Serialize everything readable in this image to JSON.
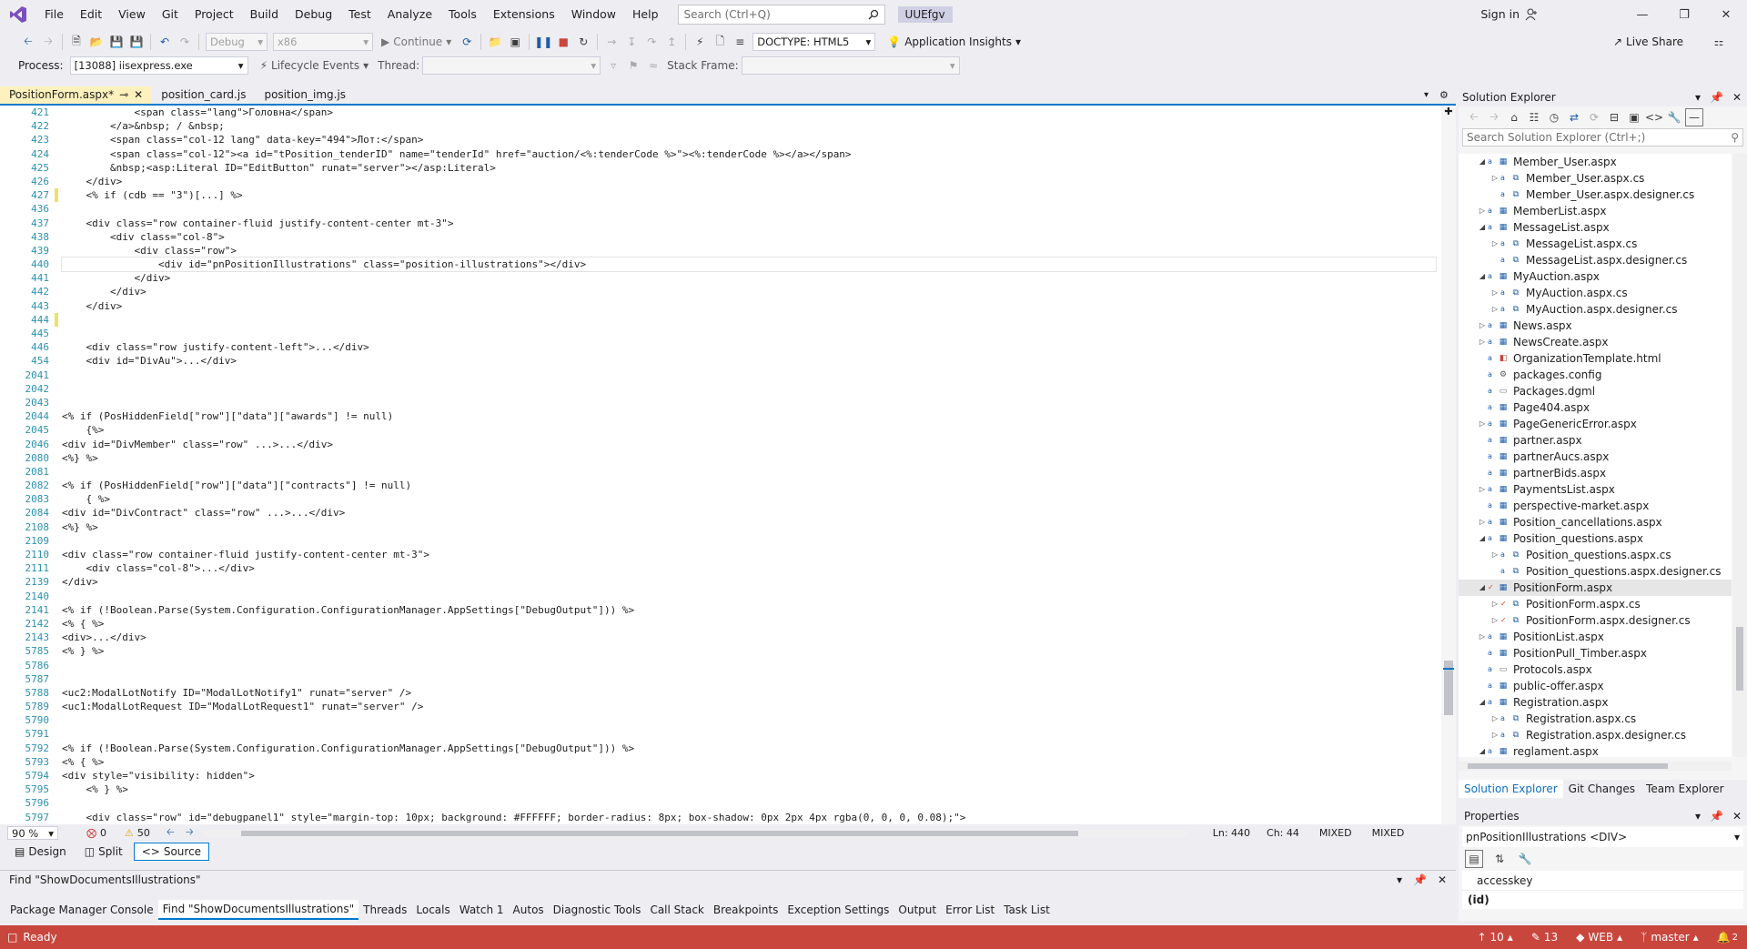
{
  "menu": [
    "File",
    "Edit",
    "View",
    "Git",
    "Project",
    "Build",
    "Debug",
    "Test",
    "Analyze",
    "Tools",
    "Extensions",
    "Window",
    "Help"
  ],
  "search": {
    "placeholder": "Search (Ctrl+Q)"
  },
  "solution_name": "UUEfgv",
  "signin": "Sign in",
  "toolbar": {
    "config": "Debug",
    "platform": "x86",
    "continue": "Continue",
    "doctype": "DOCTYPE: HTML5",
    "app_insights": "Application Insights",
    "live_share": "Live Share"
  },
  "toolbar2": {
    "process_label": "Process:",
    "process_value": "[13088] iisexpress.exe",
    "lifecycle": "Lifecycle Events",
    "thread_label": "Thread:",
    "stack_label": "Stack Frame:"
  },
  "doc_tabs": [
    {
      "label": "PositionForm.aspx*",
      "active": true
    },
    {
      "label": "position_card.js",
      "active": false
    },
    {
      "label": "position_img.js",
      "active": false
    }
  ],
  "editor": {
    "lines": [
      {
        "n": "421",
        "t": "            <span class=\"lang\">Головна</span>"
      },
      {
        "n": "422",
        "t": "        </a>&nbsp; / &nbsp;"
      },
      {
        "n": "423",
        "t": "        <span class=\"col-12 lang\" data-key=\"494\">Лот:</span>"
      },
      {
        "n": "424",
        "t": "        <span class=\"col-12\"><a id=\"tPosition_tenderID\" name=\"tenderId\" href=\"auction/<%:tenderCode %>\"><%:tenderCode %></a></span>"
      },
      {
        "n": "425",
        "t": "        &nbsp;<asp:Literal ID=\"EditButton\" runat=\"server\"></asp:Literal>"
      },
      {
        "n": "426",
        "t": "    </div>"
      },
      {
        "n": "427",
        "t": "    <% if (cdb == \"3\")[...] %>"
      },
      {
        "n": "436",
        "t": ""
      },
      {
        "n": "437",
        "t": "    <div class=\"row container-fluid justify-content-center mt-3\">"
      },
      {
        "n": "438",
        "t": "        <div class=\"col-8\">"
      },
      {
        "n": "439",
        "t": "            <div class=\"row\">"
      },
      {
        "n": "440",
        "t": "                <div id=\"pnPositionIllustrations\" class=\"position-illustrations\"></div>",
        "current": true
      },
      {
        "n": "441",
        "t": "            </div>"
      },
      {
        "n": "442",
        "t": "        </div>"
      },
      {
        "n": "443",
        "t": "    </div>"
      },
      {
        "n": "444",
        "t": ""
      },
      {
        "n": "445",
        "t": ""
      },
      {
        "n": "446",
        "t": "    <div class=\"row justify-content-left\">...</div>"
      },
      {
        "n": "454",
        "t": "    <div id=\"DivAu\">...</div>"
      },
      {
        "n": "2041",
        "t": ""
      },
      {
        "n": "2042",
        "t": ""
      },
      {
        "n": "2043",
        "t": ""
      },
      {
        "n": "2044",
        "t": "<% if (PosHiddenField[\"row\"][\"data\"][\"awards\"] != null)"
      },
      {
        "n": "2045",
        "t": "    {%>"
      },
      {
        "n": "2046",
        "t": "<div id=\"DivMember\" class=\"row\" ...>...</div>"
      },
      {
        "n": "2080",
        "t": "<%} %>"
      },
      {
        "n": "2081",
        "t": ""
      },
      {
        "n": "2082",
        "t": "<% if (PosHiddenField[\"row\"][\"data\"][\"contracts\"] != null)"
      },
      {
        "n": "2083",
        "t": "    { %>"
      },
      {
        "n": "2084",
        "t": "<div id=\"DivContract\" class=\"row\" ...>...</div>"
      },
      {
        "n": "2108",
        "t": "<%} %>"
      },
      {
        "n": "2109",
        "t": ""
      },
      {
        "n": "2110",
        "t": "<div class=\"row container-fluid justify-content-center mt-3\">"
      },
      {
        "n": "2111",
        "t": "    <div class=\"col-8\">...</div>"
      },
      {
        "n": "2139",
        "t": "</div>"
      },
      {
        "n": "2140",
        "t": ""
      },
      {
        "n": "2141",
        "t": "<% if (!Boolean.Parse(System.Configuration.ConfigurationManager.AppSettings[\"DebugOutput\"])) %>"
      },
      {
        "n": "2142",
        "t": "<% { %>"
      },
      {
        "n": "2143",
        "t": "<div>...</div>"
      },
      {
        "n": "5785",
        "t": "<% } %>"
      },
      {
        "n": "5786",
        "t": ""
      },
      {
        "n": "5787",
        "t": ""
      },
      {
        "n": "5788",
        "t": "<uc2:ModalLotNotify ID=\"ModalLotNotify1\" runat=\"server\" />"
      },
      {
        "n": "5789",
        "t": "<uc1:ModalLotRequest ID=\"ModalLotRequest1\" runat=\"server\" />"
      },
      {
        "n": "5790",
        "t": ""
      },
      {
        "n": "5791",
        "t": ""
      },
      {
        "n": "5792",
        "t": "<% if (!Boolean.Parse(System.Configuration.ConfigurationManager.AppSettings[\"DebugOutput\"])) %>"
      },
      {
        "n": "5793",
        "t": "<% { %>"
      },
      {
        "n": "5794",
        "t": "<div style=\"visibility: hidden\">"
      },
      {
        "n": "5795",
        "t": "    <% } %>"
      },
      {
        "n": "5796",
        "t": ""
      },
      {
        "n": "5797",
        "t": "    <div class=\"row\" id=\"debugpanel1\" style=\"margin-top: 10px; background: #FFFFFF; border-radius: 8px; box-shadow: 0px 2px 4px rgba(0, 0, 0, 0.08);\">"
      }
    ]
  },
  "editor_status": {
    "zoom": "90 %",
    "errors": "0",
    "warnings": "50",
    "ln": "Ln: 440",
    "ch": "Ch: 44",
    "enc1": "MIXED",
    "enc2": "MIXED"
  },
  "view_buttons": [
    "Design",
    "Split",
    "Source"
  ],
  "find_title": "Find \"ShowDocumentsIllustrations\"",
  "bottom_tabs": [
    "Package Manager Console",
    "Find \"ShowDocumentsIllustrations\"",
    "Threads",
    "Locals",
    "Watch 1",
    "Autos",
    "Diagnostic Tools",
    "Call Stack",
    "Breakpoints",
    "Exception Settings",
    "Output",
    "Error List",
    "Task List"
  ],
  "status": {
    "ready": "Ready",
    "up": "10",
    "pencil": "13",
    "project": "WEB",
    "branch": "master",
    "notif": "2"
  },
  "solution_explorer": {
    "title": "Solution Explorer",
    "search_placeholder": "Search Solution Explorer (Ctrl+;)",
    "items": [
      {
        "label": "Member_User.aspx",
        "depth": 0,
        "exp": "open",
        "icon": "page"
      },
      {
        "label": "Member_User.aspx.cs",
        "depth": 1,
        "exp": "closed",
        "icon": "cs"
      },
      {
        "label": "Member_User.aspx.designer.cs",
        "depth": 1,
        "exp": "",
        "icon": "cs"
      },
      {
        "label": "MemberList.aspx",
        "depth": 0,
        "exp": "closed",
        "icon": "page"
      },
      {
        "label": "MessageList.aspx",
        "depth": 0,
        "exp": "open",
        "icon": "page"
      },
      {
        "label": "MessageList.aspx.cs",
        "depth": 1,
        "exp": "closed",
        "icon": "cs"
      },
      {
        "label": "MessageList.aspx.designer.cs",
        "depth": 1,
        "exp": "",
        "icon": "cs"
      },
      {
        "label": "MyAuction.aspx",
        "depth": 0,
        "exp": "open",
        "icon": "page"
      },
      {
        "label": "MyAuction.aspx.cs",
        "depth": 1,
        "exp": "closed",
        "icon": "cs"
      },
      {
        "label": "MyAuction.aspx.designer.cs",
        "depth": 1,
        "exp": "closed",
        "icon": "cs"
      },
      {
        "label": "News.aspx",
        "depth": 0,
        "exp": "closed",
        "icon": "page"
      },
      {
        "label": "NewsCreate.aspx",
        "depth": 0,
        "exp": "closed",
        "icon": "page"
      },
      {
        "label": "OrganizationTemplate.html",
        "depth": 0,
        "exp": "",
        "icon": "html"
      },
      {
        "label": "packages.config",
        "depth": 0,
        "exp": "",
        "icon": "config"
      },
      {
        "label": "Packages.dgml",
        "depth": 0,
        "exp": "",
        "icon": "file"
      },
      {
        "label": "Page404.aspx",
        "depth": 0,
        "exp": "",
        "icon": "page"
      },
      {
        "label": "PageGenericError.aspx",
        "depth": 0,
        "exp": "closed",
        "icon": "page"
      },
      {
        "label": "partner.aspx",
        "depth": 0,
        "exp": "",
        "icon": "page"
      },
      {
        "label": "partnerAucs.aspx",
        "depth": 0,
        "exp": "",
        "icon": "page"
      },
      {
        "label": "partnerBids.aspx",
        "depth": 0,
        "exp": "",
        "icon": "page"
      },
      {
        "label": "PaymentsList.aspx",
        "depth": 0,
        "exp": "closed",
        "icon": "page"
      },
      {
        "label": "perspective-market.aspx",
        "depth": 0,
        "exp": "",
        "icon": "page"
      },
      {
        "label": "Position_cancellations.aspx",
        "depth": 0,
        "exp": "closed",
        "icon": "page"
      },
      {
        "label": "Position_questions.aspx",
        "depth": 0,
        "exp": "open",
        "icon": "page"
      },
      {
        "label": "Position_questions.aspx.cs",
        "depth": 1,
        "exp": "closed",
        "icon": "cs"
      },
      {
        "label": "Position_questions.aspx.designer.cs",
        "depth": 1,
        "exp": "",
        "icon": "cs"
      },
      {
        "label": "PositionForm.aspx",
        "depth": 0,
        "exp": "open",
        "icon": "page",
        "selected": true
      },
      {
        "label": "PositionForm.aspx.cs",
        "depth": 1,
        "exp": "closed",
        "icon": "cs"
      },
      {
        "label": "PositionForm.aspx.designer.cs",
        "depth": 1,
        "exp": "closed",
        "icon": "cs"
      },
      {
        "label": "PositionList.aspx",
        "depth": 0,
        "exp": "closed",
        "icon": "page"
      },
      {
        "label": "PositionPull_Timber.aspx",
        "depth": 0,
        "exp": "",
        "icon": "page"
      },
      {
        "label": "Protocols.aspx",
        "depth": 0,
        "exp": "",
        "icon": "file"
      },
      {
        "label": "public-offer.aspx",
        "depth": 0,
        "exp": "",
        "icon": "page"
      },
      {
        "label": "Registration.aspx",
        "depth": 0,
        "exp": "open",
        "icon": "page"
      },
      {
        "label": "Registration.aspx.cs",
        "depth": 1,
        "exp": "closed",
        "icon": "cs"
      },
      {
        "label": "Registration.aspx.designer.cs",
        "depth": 1,
        "exp": "closed",
        "icon": "cs"
      },
      {
        "label": "reglament.aspx",
        "depth": 0,
        "exp": "open",
        "icon": "page"
      }
    ],
    "tabs": [
      "Solution Explorer",
      "Git Changes",
      "Team Explorer"
    ]
  },
  "properties": {
    "title": "Properties",
    "object_name": "pnPositionIllustrations",
    "object_type": "<DIV>",
    "prop1": "accesskey",
    "prop2": "(id)"
  }
}
